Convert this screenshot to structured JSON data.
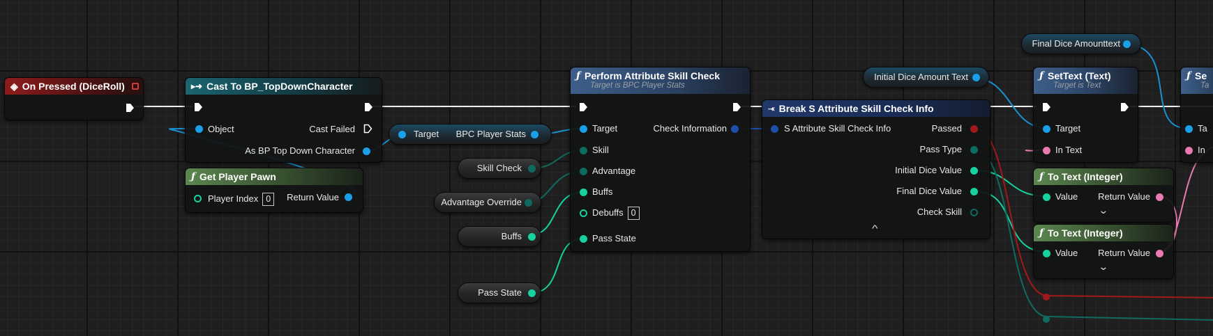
{
  "colors": {
    "object": "#1aa0e8",
    "struct": "#1d4ea8",
    "byte": "#0f6b5f",
    "struct_member": "#17d1a0",
    "text": "#e87ab0",
    "bool": "#a1191b",
    "exec": "#ffffff"
  },
  "nodes": {
    "on_pressed": {
      "title": "On Pressed (DiceRoll)"
    },
    "cast": {
      "title": "Cast To BP_TopDownCharacter",
      "object": "Object",
      "cast_failed": "Cast Failed",
      "as_char": "As BP Top Down Character"
    },
    "get_pawn": {
      "title": "Get Player Pawn",
      "player_index": "Player Index",
      "player_index_value": "0",
      "return_value": "Return Value"
    },
    "target_node": {
      "target": "Target",
      "output": "BPC Player Stats"
    },
    "perform": {
      "title": "Perform Attribute Skill Check",
      "subtitle": "Target is BPC Player Stats",
      "target": "Target",
      "skill": "Skill",
      "advantage": "Advantage",
      "buffs": "Buffs",
      "debuffs": "Debuffs",
      "debuffs_value": "0",
      "pass_state": "Pass State",
      "check_info": "Check Information"
    },
    "break": {
      "title": "Break S Attribute Skill Check Info",
      "input": "S Attribute Skill Check Info",
      "passed": "Passed",
      "pass_type": "Pass Type",
      "initial": "Initial Dice Value",
      "final": "Final Dice Value",
      "check_skill": "Check Skill",
      "collapse": "^"
    },
    "settext": {
      "title": "SetText (Text)",
      "subtitle": "Target is Text",
      "target": "Target",
      "in_text": "In Text"
    },
    "settext2": {
      "title": "Se",
      "subtitle": "Ta",
      "target": "Ta",
      "in_text": "In"
    },
    "totext1": {
      "title": "To Text (Integer)",
      "value": "Value",
      "return_value": "Return Value",
      "expand": "⌄"
    },
    "totext2": {
      "title": "To Text (Integer)",
      "value": "Value",
      "return_value": "Return Value",
      "expand": "⌄"
    }
  },
  "variables": {
    "skill_check": "Skill Check",
    "advantage_override": "Advantage Override",
    "buffs": "Buffs",
    "pass_state": "Pass State",
    "initial_dice_amount_text": "Initial Dice Amount Text",
    "final_dice_amount_text": "Final Dice Amounttext"
  },
  "icons": {
    "event": "event-diamond-icon",
    "cast": "cast-arrow-icon",
    "function": "function-f-icon",
    "break": "break-struct-icon"
  }
}
